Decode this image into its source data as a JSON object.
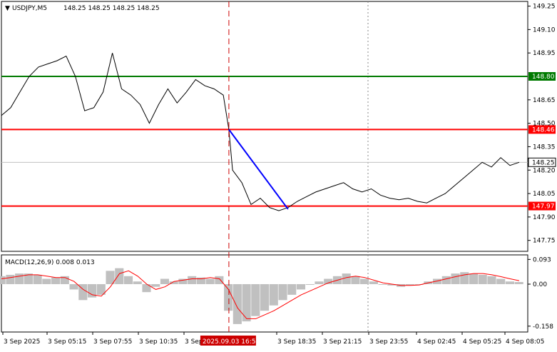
{
  "main_chart": {
    "header_symbol": "USDJPY,M5",
    "header_ohlc": "148.25 148.25 148.25 148.25",
    "ylim": [
      147.68,
      149.28
    ],
    "y_ticks": [
      "149.25",
      "149.10",
      "148.95",
      "148.65",
      "148.50",
      "148.35",
      "148.20",
      "148.05",
      "147.90",
      "147.75"
    ],
    "levels": [
      {
        "price": 148.8,
        "label": "148.80",
        "color": "#007a00"
      },
      {
        "price": 148.46,
        "label": "148.46",
        "color": "#ff0000"
      },
      {
        "price": 147.97,
        "label": "147.97",
        "color": "#ff0000"
      }
    ],
    "current_price": {
      "price": 148.25,
      "label": "148.25"
    },
    "trend_line": {
      "color": "#0000ff",
      "start": {
        "x": 24.6,
        "y": 148.46
      },
      "end": {
        "x": 31.0,
        "y": 147.95
      }
    },
    "series": {
      "name": "USDJPY close",
      "color": "#000000",
      "x": [
        0,
        1,
        2,
        3,
        4,
        5,
        6,
        7,
        8,
        9,
        10,
        11,
        12,
        13,
        14,
        15,
        16,
        17,
        18,
        19,
        20,
        21,
        22,
        23,
        24,
        24.6,
        25,
        26,
        27,
        28,
        29,
        30,
        31,
        32,
        33,
        34,
        35,
        36,
        37,
        38,
        39,
        40,
        41,
        42,
        43,
        44,
        45,
        46,
        47,
        48,
        49,
        50,
        51,
        52,
        53,
        54,
        55,
        56
      ],
      "y": [
        148.55,
        148.6,
        148.7,
        148.8,
        148.86,
        148.88,
        148.9,
        148.93,
        148.8,
        148.58,
        148.6,
        148.7,
        148.95,
        148.72,
        148.68,
        148.62,
        148.5,
        148.62,
        148.72,
        148.63,
        148.7,
        148.78,
        148.74,
        148.72,
        148.68,
        148.46,
        148.2,
        148.12,
        147.98,
        148.02,
        147.96,
        147.94,
        147.96,
        148.0,
        148.03,
        148.06,
        148.08,
        148.1,
        148.12,
        148.08,
        148.06,
        148.08,
        148.04,
        148.02,
        148.01,
        148.02,
        148.0,
        147.99,
        148.02,
        148.05,
        148.1,
        148.15,
        148.2,
        148.25,
        148.22,
        148.28,
        148.23,
        148.25
      ]
    }
  },
  "macd": {
    "label": "MACD(12,26,9) 0.008 0.013",
    "ylim": [
      -0.18,
      0.11
    ],
    "y_ticks": [
      "0.093",
      "0.00",
      "-0.158"
    ],
    "histogram_color": "#c0c0c0",
    "signal_color": "#ff0000",
    "histogram": [
      0.03,
      0.035,
      0.04,
      0.04,
      0.035,
      0.02,
      0.025,
      0.03,
      -0.02,
      -0.06,
      -0.05,
      -0.04,
      0.05,
      0.06,
      0.03,
      0.01,
      -0.03,
      -0.01,
      0.02,
      0.01,
      0.02,
      0.03,
      0.025,
      0.02,
      0.03,
      -0.1,
      -0.15,
      -0.14,
      -0.12,
      -0.1,
      -0.08,
      -0.06,
      -0.04,
      -0.02,
      0.0,
      0.01,
      0.02,
      0.03,
      0.04,
      0.03,
      0.02,
      0.01,
      0.0,
      -0.005,
      -0.01,
      -0.005,
      0.0,
      0.01,
      0.02,
      0.03,
      0.04,
      0.045,
      0.04,
      0.035,
      0.03,
      0.02,
      0.01,
      0.008
    ],
    "signal": [
      0.02,
      0.025,
      0.03,
      0.035,
      0.035,
      0.03,
      0.025,
      0.025,
      0.01,
      -0.02,
      -0.04,
      -0.045,
      -0.01,
      0.04,
      0.05,
      0.03,
      0.0,
      -0.02,
      -0.01,
      0.01,
      0.015,
      0.02,
      0.02,
      0.025,
      0.02,
      -0.02,
      -0.09,
      -0.13,
      -0.13,
      -0.115,
      -0.1,
      -0.08,
      -0.06,
      -0.04,
      -0.025,
      -0.01,
      0.005,
      0.015,
      0.025,
      0.03,
      0.025,
      0.015,
      0.005,
      0.0,
      -0.005,
      -0.005,
      -0.003,
      0.005,
      0.012,
      0.02,
      0.028,
      0.035,
      0.04,
      0.04,
      0.035,
      0.028,
      0.02,
      0.013
    ]
  },
  "time_axis": {
    "labels": [
      "3 Sep 2025",
      "3 Sep 05:15",
      "3 Sep 07:55",
      "3 Sep 10:35",
      "3 Sep 13:15",
      "3 Sep 18:35",
      "3 Sep 21:15",
      "3 Sep 23:55",
      "4 Sep 02:45",
      "4 Sep 05:25",
      "4 Sep 08:05"
    ],
    "cursor_label": "2025.09.03 16:55"
  },
  "colors": {
    "background": "#ffffff",
    "grid": "#d0d0d0",
    "axis": "#000000",
    "cursor_line": "#cc0000",
    "level_label_text": "#ffffff"
  }
}
